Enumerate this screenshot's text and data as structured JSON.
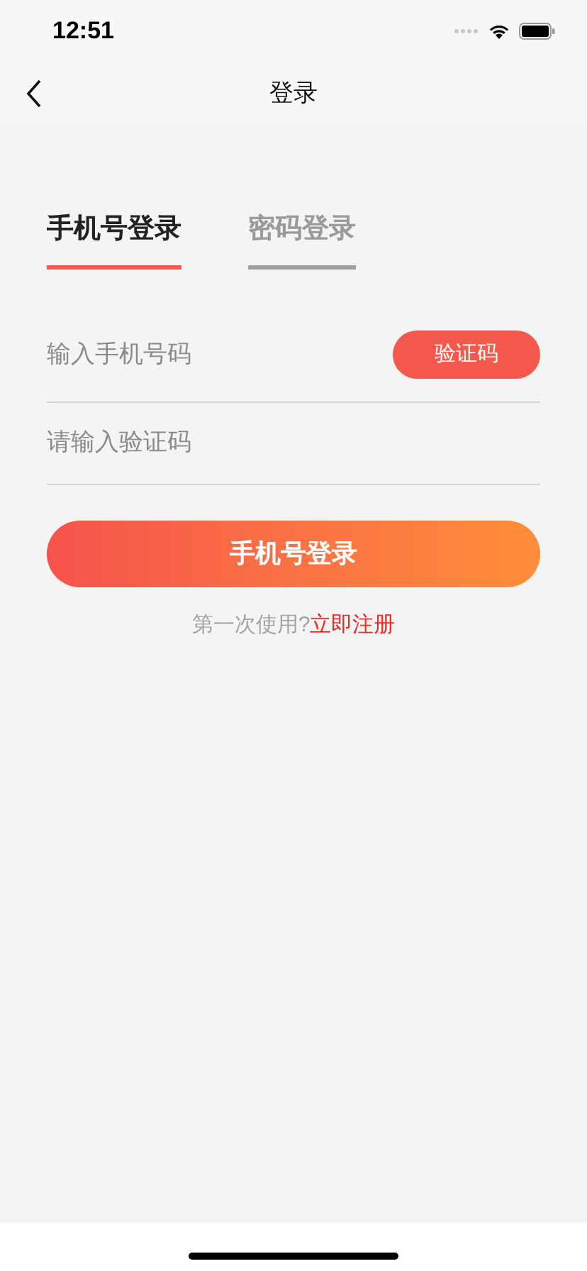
{
  "status_bar": {
    "time": "12:51"
  },
  "nav": {
    "title": "登录"
  },
  "tabs": [
    {
      "label": "手机号登录",
      "selected": true
    },
    {
      "label": "密码登录",
      "selected": false
    }
  ],
  "fields": [
    {
      "placeholder": "输入手机号码",
      "action": "验证码"
    },
    {
      "placeholder": "请输入验证码"
    }
  ],
  "submit": "手机号登录",
  "register": {
    "prompt": "第一次使用?",
    "link": "立即注册"
  }
}
